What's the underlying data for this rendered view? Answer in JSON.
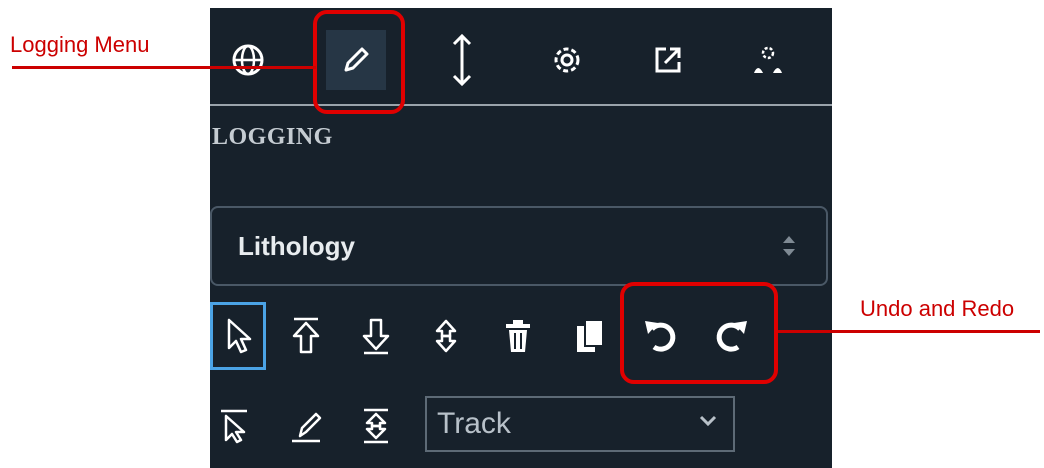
{
  "panel": {
    "section_title": "LOGGING",
    "top_icons": [
      "globe-icon",
      "pencil-icon",
      "vertical-arrows-icon",
      "gear-icon",
      "external-link-icon",
      "users-settings-icon"
    ],
    "active_top_icon": "pencil-icon",
    "lithology_select": {
      "value": "Lithology"
    },
    "tools_row1": [
      "pointer-icon",
      "extend-up-icon",
      "extend-down-icon",
      "split-icon",
      "trash-icon",
      "copy-icon",
      "undo-icon",
      "redo-icon"
    ],
    "selected_tool": "pointer-icon",
    "tools_row2": [
      "select-area-icon",
      "draw-icon",
      "merge-icon"
    ],
    "track_select": {
      "value": "Track"
    }
  },
  "annotations": {
    "logging_menu": "Logging Menu",
    "undo_redo": "Undo and Redo",
    "color": "#cc0000"
  },
  "colors": {
    "panel_bg": "#17212b",
    "selected_tool_border": "#4ba3e6"
  }
}
